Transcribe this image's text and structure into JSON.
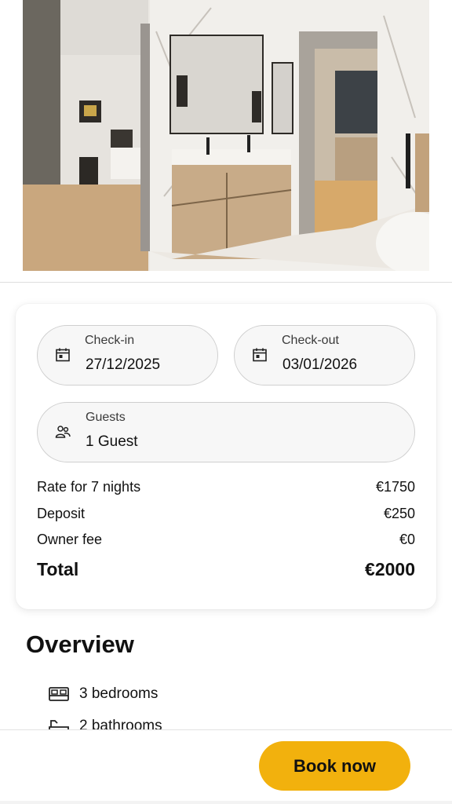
{
  "hero": {
    "image_description_icon": "bathroom-photo"
  },
  "booking": {
    "checkin": {
      "label": "Check-in",
      "value": "27/12/2025",
      "icon": "calendar-icon"
    },
    "checkout": {
      "label": "Check-out",
      "value": "03/01/2026",
      "icon": "calendar-icon"
    },
    "guests": {
      "label": "Guests",
      "value": "1 Guest",
      "icon": "people-icon"
    },
    "prices": [
      {
        "label": "Rate for 7 nights",
        "amount": "€1750"
      },
      {
        "label": "Deposit",
        "amount": "€250"
      },
      {
        "label": "Owner fee",
        "amount": "€0"
      }
    ],
    "total": {
      "label": "Total",
      "amount": "€2000"
    }
  },
  "overview": {
    "title": "Overview",
    "features": [
      {
        "text": "3 bedrooms",
        "icon": "bed-icon"
      },
      {
        "text": "2 bathrooms",
        "icon": "bathtub-icon"
      }
    ]
  },
  "cta": {
    "book_label": "Book now",
    "accent_color": "#f2b10d"
  }
}
